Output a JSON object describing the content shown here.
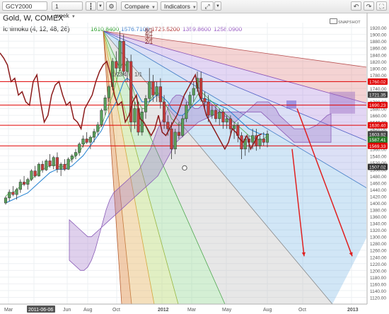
{
  "toolbar": {
    "symbol": "GCY2000",
    "interval": "1 week",
    "compare_label": "Compare",
    "indicators_label": "Indicators"
  },
  "header": {
    "title": "Gold, W, COMEX",
    "indicator_name": "Ichimoku (4, 12, 48, 26)",
    "indicator_values": [
      "1610.8400",
      "1576.7100",
      "1725.5200",
      "1359.8600",
      "1258.0900"
    ],
    "snapshot_label": "SNAPSHOT"
  },
  "colors": {
    "price_line": "#8b1a1a",
    "up_candle": "#5aa05a",
    "down_candle": "#c83c3c",
    "kijun": "#1f7fd0",
    "tenkan": "#2aa02a",
    "cloud": "#9a6cc4",
    "hline": "#e00000",
    "arrow": "#e02020",
    "gann_labels": "#7a2020",
    "val_green": "#2aa02a",
    "val_blue": "#3a7fd0",
    "val_red": "#b03030",
    "val_purple": "#9a5cc4"
  },
  "chart_data": {
    "type": "candlestick",
    "title": "Gold, W, COMEX",
    "y_ticks": [
      1120,
      1140,
      1160,
      1180,
      1200,
      1220,
      1240,
      1260,
      1280,
      1300,
      1320,
      1340,
      1360,
      1380,
      1400,
      1420,
      1440,
      1460,
      1480,
      1500,
      1520,
      1540,
      1560,
      1580,
      1600,
      1620,
      1640,
      1660,
      1680,
      1700,
      1720,
      1740,
      1760,
      1780,
      1800,
      1820,
      1840,
      1860,
      1880,
      1900,
      1920
    ],
    "ylim": [
      1100,
      1935
    ],
    "x_labels": [
      "Mar",
      "2011-06-06",
      "Jun",
      "Aug",
      "Oct",
      "2012",
      "Mar",
      "May",
      "Aug",
      "Oct",
      "2013"
    ],
    "price_levels": [
      {
        "label": "1760.02",
        "value": 1760.02,
        "color": "#e00000"
      },
      {
        "label": "1721.35",
        "value": 1721.35,
        "color": "#444444"
      },
      {
        "label": "1690.23",
        "value": 1690.23,
        "color": "#e00000"
      },
      {
        "label": "1630.40",
        "value": 1630.4,
        "color": "#e00000"
      },
      {
        "label": "1603.92",
        "value": 1603.92,
        "color": "#444444"
      },
      {
        "label": "1587.41",
        "value": 1587.41,
        "color": "#2a7a2a"
      },
      {
        "label": "1569.33",
        "value": 1569.33,
        "color": "#e00000"
      },
      {
        "label": "1507.02",
        "value": 1507.02,
        "color": "#333333"
      }
    ],
    "gann_labels": [
      "8/1",
      "4/1",
      "3/1",
      "2/1",
      "1/1",
      "3/4",
      "1/2"
    ],
    "ohlc": [
      [
        1400,
        1420,
        1395,
        1415
      ],
      [
        1415,
        1440,
        1405,
        1432
      ],
      [
        1432,
        1450,
        1420,
        1425
      ],
      [
        1425,
        1445,
        1410,
        1440
      ],
      [
        1440,
        1470,
        1430,
        1462
      ],
      [
        1462,
        1480,
        1450,
        1455
      ],
      [
        1455,
        1475,
        1440,
        1470
      ],
      [
        1470,
        1500,
        1465,
        1495
      ],
      [
        1495,
        1510,
        1475,
        1480
      ],
      [
        1480,
        1520,
        1478,
        1515
      ],
      [
        1515,
        1525,
        1490,
        1498
      ],
      [
        1498,
        1530,
        1495,
        1525
      ],
      [
        1525,
        1545,
        1505,
        1510
      ],
      [
        1510,
        1540,
        1500,
        1535
      ],
      [
        1535,
        1550,
        1490,
        1500
      ],
      [
        1500,
        1520,
        1480,
        1515
      ],
      [
        1515,
        1530,
        1495,
        1500
      ],
      [
        1500,
        1535,
        1498,
        1530
      ],
      [
        1530,
        1545,
        1520,
        1540
      ],
      [
        1540,
        1560,
        1530,
        1550
      ],
      [
        1550,
        1580,
        1540,
        1575
      ],
      [
        1575,
        1600,
        1565,
        1590
      ],
      [
        1590,
        1610,
        1575,
        1580
      ],
      [
        1580,
        1600,
        1560,
        1595
      ],
      [
        1595,
        1620,
        1580,
        1612
      ],
      [
        1612,
        1640,
        1600,
        1632
      ],
      [
        1632,
        1680,
        1625,
        1675
      ],
      [
        1675,
        1720,
        1660,
        1712
      ],
      [
        1712,
        1750,
        1700,
        1745
      ],
      [
        1745,
        1830,
        1735,
        1820
      ],
      [
        1820,
        1850,
        1780,
        1800
      ],
      [
        1800,
        1910,
        1790,
        1880
      ],
      [
        1880,
        1900,
        1780,
        1790
      ],
      [
        1790,
        1830,
        1760,
        1820
      ],
      [
        1820,
        1840,
        1610,
        1640
      ],
      [
        1640,
        1700,
        1620,
        1680
      ],
      [
        1680,
        1700,
        1600,
        1610
      ],
      [
        1610,
        1680,
        1600,
        1670
      ],
      [
        1670,
        1720,
        1650,
        1710
      ],
      [
        1710,
        1800,
        1700,
        1760
      ],
      [
        1760,
        1780,
        1700,
        1720
      ],
      [
        1720,
        1760,
        1700,
        1745
      ],
      [
        1745,
        1770,
        1680,
        1700
      ],
      [
        1700,
        1720,
        1620,
        1640
      ],
      [
        1640,
        1660,
        1600,
        1620
      ],
      [
        1620,
        1640,
        1530,
        1560
      ],
      [
        1560,
        1620,
        1545,
        1610
      ],
      [
        1610,
        1640,
        1590,
        1600
      ],
      [
        1600,
        1660,
        1595,
        1650
      ],
      [
        1650,
        1700,
        1640,
        1690
      ],
      [
        1690,
        1730,
        1680,
        1720
      ],
      [
        1720,
        1760,
        1700,
        1740
      ],
      [
        1740,
        1790,
        1730,
        1770
      ],
      [
        1770,
        1790,
        1700,
        1710
      ],
      [
        1710,
        1730,
        1680,
        1700
      ],
      [
        1700,
        1720,
        1640,
        1660
      ],
      [
        1660,
        1690,
        1650,
        1675
      ],
      [
        1675,
        1690,
        1640,
        1650
      ],
      [
        1650,
        1680,
        1630,
        1670
      ],
      [
        1670,
        1680,
        1620,
        1640
      ],
      [
        1640,
        1660,
        1620,
        1650
      ],
      [
        1650,
        1660,
        1600,
        1620
      ],
      [
        1620,
        1640,
        1590,
        1630
      ],
      [
        1630,
        1640,
        1580,
        1600
      ],
      [
        1600,
        1610,
        1530,
        1560
      ],
      [
        1560,
        1600,
        1540,
        1590
      ],
      [
        1590,
        1600,
        1550,
        1580
      ],
      [
        1580,
        1620,
        1560,
        1600
      ],
      [
        1600,
        1620,
        1555,
        1570
      ],
      [
        1570,
        1600,
        1560,
        1590
      ],
      [
        1590,
        1610,
        1570,
        1580
      ],
      [
        1580,
        1615,
        1565,
        1605
      ]
    ],
    "price_line": [
      1845,
      1830,
      1810,
      1760,
      1770,
      1720,
      1730,
      1700,
      1690,
      1760,
      1780,
      1700,
      1640,
      1660,
      1720,
      1750,
      1760,
      1720,
      1690,
      1700,
      1650,
      1640,
      1620,
      1680,
      1700,
      1720,
      1760,
      1790,
      1810,
      1820,
      1780,
      1720,
      1690,
      1700,
      1640,
      1660,
      1700,
      1720,
      1650,
      1640,
      1620,
      1600,
      1620,
      1660,
      1610,
      1600,
      1620,
      1640,
      1660,
      1690,
      1720,
      1740,
      1760,
      1780,
      1720,
      1700,
      1660,
      1640,
      1620,
      1600,
      1580,
      1560,
      1580,
      1620,
      1610,
      1590,
      1580,
      1600,
      1560,
      1580,
      1600,
      1605
    ],
    "tenkan": [
      1420,
      1430,
      1430,
      1440,
      1450,
      1460,
      1460,
      1470,
      1480,
      1490,
      1500,
      1505,
      1510,
      1515,
      1510,
      1505,
      1510,
      1520,
      1530,
      1540,
      1550,
      1570,
      1585,
      1590,
      1600,
      1615,
      1630,
      1660,
      1690,
      1720,
      1760,
      1800,
      1820,
      1800,
      1760,
      1720,
      1700,
      1680,
      1680,
      1700,
      1720,
      1730,
      1720,
      1700,
      1680,
      1650,
      1640,
      1630,
      1640,
      1660,
      1680,
      1700,
      1720,
      1730,
      1720,
      1710,
      1700,
      1690,
      1680,
      1670,
      1660,
      1650,
      1640,
      1630,
      1620,
      1610,
      1600,
      1595,
      1590,
      1585,
      1590,
      1600
    ],
    "kijun": [
      1400,
      1405,
      1410,
      1415,
      1420,
      1425,
      1430,
      1440,
      1450,
      1460,
      1470,
      1480,
      1490,
      1495,
      1500,
      1500,
      1500,
      1505,
      1510,
      1520,
      1530,
      1540,
      1555,
      1570,
      1585,
      1600,
      1615,
      1640,
      1660,
      1680,
      1700,
      1730,
      1760,
      1770,
      1760,
      1740,
      1720,
      1700,
      1700,
      1700,
      1710,
      1720,
      1720,
      1710,
      1700,
      1680,
      1670,
      1660,
      1660,
      1670,
      1680,
      1690,
      1700,
      1710,
      1710,
      1705,
      1700,
      1695,
      1690,
      1685,
      1680,
      1670,
      1660,
      1650,
      1640,
      1630,
      1620,
      1615,
      1610,
      1605,
      1605,
      1600
    ],
    "cloud_a": [
      1230,
      1220,
      1210,
      1200,
      1200,
      1210,
      1230,
      1260,
      1300,
      1340,
      1380,
      1410,
      1430,
      1440,
      1450,
      1460,
      1470,
      1480,
      1490,
      1500,
      1520,
      1540,
      1560,
      1590,
      1620,
      1640,
      1660,
      1690,
      1710,
      1720,
      1720,
      1715,
      1700,
      1690,
      1680,
      1680,
      1690,
      1700,
      1700,
      1690,
      1680,
      1670,
      1660,
      1650,
      1640,
      1640,
      1650,
      1660,
      1670,
      1680,
      1690,
      1700,
      1700,
      1700,
      1700,
      1690,
      1680,
      1660,
      1650,
      1640,
      1630,
      1620,
      1620,
      1620,
      1620,
      1620,
      1625,
      1630,
      1640,
      1650,
      1660,
      1665
    ],
    "cloud_b": [
      1350,
      1340,
      1330,
      1320,
      1310,
      1300,
      1300,
      1310,
      1320,
      1330,
      1340,
      1350,
      1360,
      1370,
      1380,
      1390,
      1400,
      1410,
      1420,
      1430,
      1440,
      1450,
      1460,
      1470,
      1480,
      1500,
      1520,
      1540,
      1560,
      1580,
      1590,
      1600,
      1610,
      1620,
      1630,
      1640,
      1645,
      1650,
      1655,
      1660,
      1665,
      1670,
      1670,
      1670,
      1670,
      1670,
      1670,
      1670,
      1670,
      1670,
      1670,
      1670,
      1670,
      1660,
      1650,
      1640,
      1630,
      1620,
      1610,
      1600,
      1590,
      1580,
      1580,
      1580,
      1580,
      1580,
      1580,
      1580,
      1580,
      1580,
      1580,
      1580
    ]
  }
}
